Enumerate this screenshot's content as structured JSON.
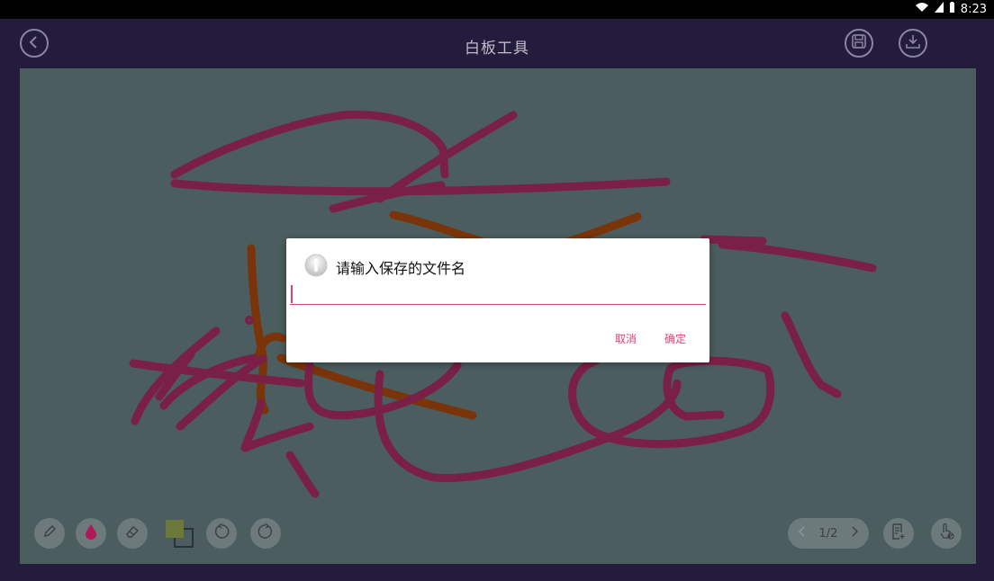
{
  "status_bar": {
    "time": "8:23"
  },
  "app_bar": {
    "title": "白板工具",
    "back_icon": "back-icon",
    "save_icon": "save-icon",
    "download_icon": "download-icon"
  },
  "toolbar": {
    "tools": [
      "pen-icon",
      "color-drop-icon",
      "eraser-icon",
      "color-swatch-icon",
      "undo-icon",
      "redo-icon"
    ],
    "pen_color": "#8b1e4b",
    "current_color": "#6b7a3a"
  },
  "pager": {
    "page": "1/2"
  },
  "side_tools": [
    "notes-icon",
    "touch-mode-icon"
  ],
  "dialog": {
    "title": "请输入保存的文件名",
    "input_value": "",
    "cancel_label": "取消",
    "confirm_label": "确定",
    "accent": "#e0407a"
  },
  "colors": {
    "board": "#4b5d5e",
    "frame": "#241c3d",
    "stroke_red": "#7a2046",
    "stroke_orange": "#7a3409"
  }
}
